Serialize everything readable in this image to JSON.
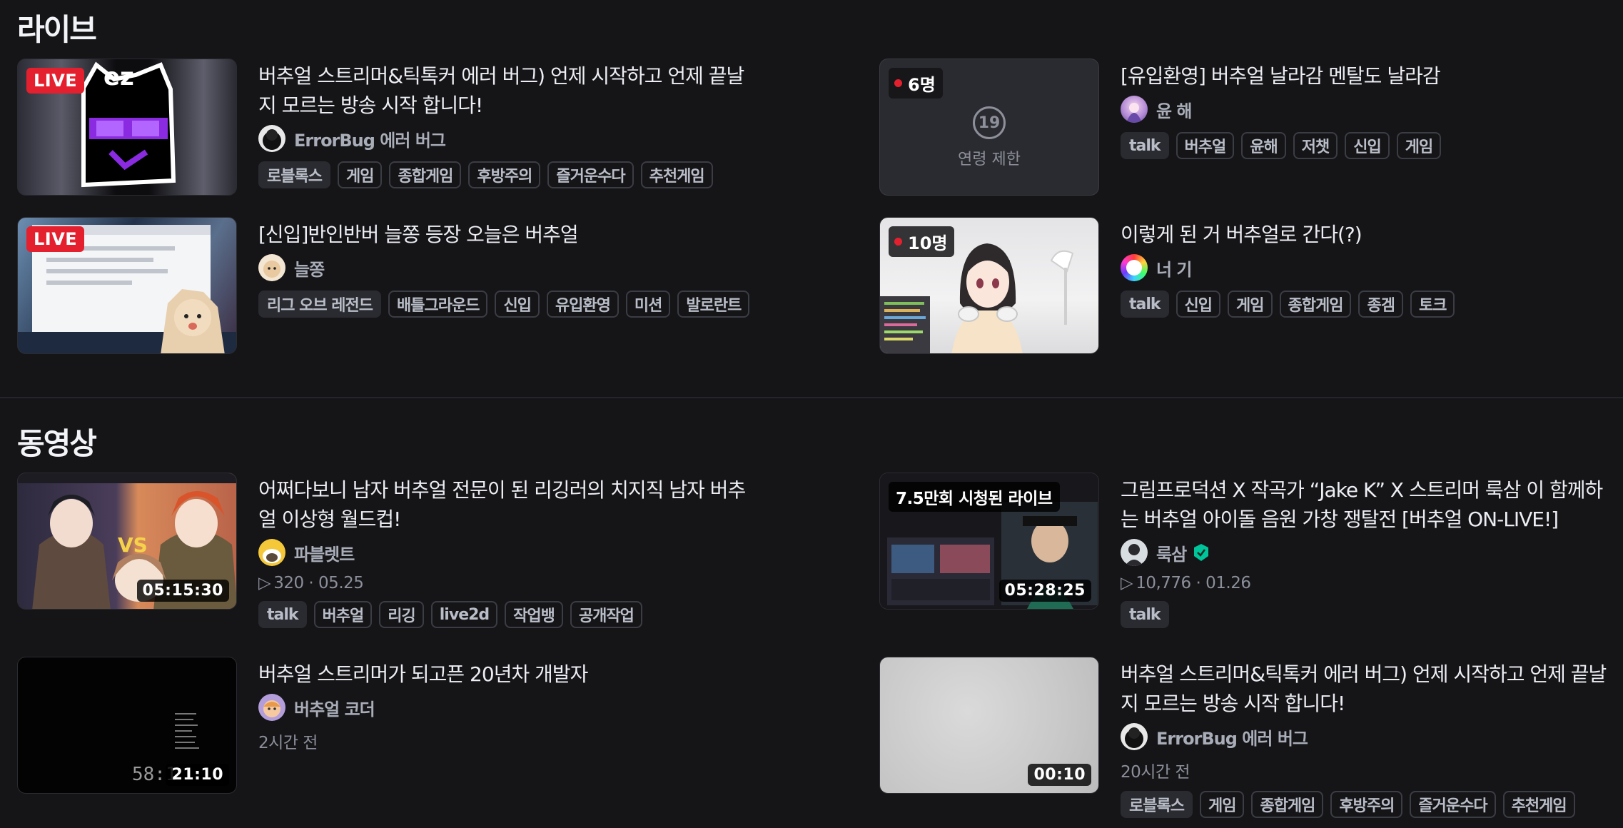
{
  "sections": {
    "live_title": "라이브",
    "video_title": "동영상"
  },
  "live": [
    {
      "badge": "LIVE",
      "title": "버추얼 스트리머&틱톡커 에러 버그) 언제 시작하고 언제 끝날지 모르는 방송 시작 합니다!",
      "channel": "ErrorBug 에러 버그",
      "tags": [
        "로블록스",
        "게임",
        "종합게임",
        "후방주의",
        "즐거운수다",
        "추천게임"
      ]
    },
    {
      "badge": "6명",
      "age_badge": "19",
      "age_text": "연령 제한",
      "title": "[유입환영] 버추얼 날라감 멘탈도 날라감",
      "channel": "윤 해",
      "tags": [
        "talk",
        "버추얼",
        "윤해",
        "저챗",
        "신입",
        "게임"
      ]
    },
    {
      "badge": "LIVE",
      "title": "[신입]반인반버 늘쫑 등장 오늘은 버추얼",
      "channel": "늘쫑",
      "tags": [
        "리그 오브 레전드",
        "배틀그라운드",
        "신입",
        "유입환영",
        "미션",
        "발로란트"
      ]
    },
    {
      "badge": "10명",
      "title": "이렇게 된 거 버추얼로 간다(?)",
      "channel": "너 기",
      "tags": [
        "talk",
        "신입",
        "게임",
        "종합게임",
        "종겜",
        "토크"
      ]
    }
  ],
  "videos": [
    {
      "duration": "05:15:30",
      "title": "어쩌다보니 남자 버추얼 전문이 된 리깅러의 치지직 남자 버추얼 이상형 월드컵!",
      "channel": "파블렛트",
      "views": "320",
      "date": "05.25",
      "tags": [
        "talk",
        "버추얼",
        "리깅",
        "live2d",
        "작업뱅",
        "공개작업"
      ]
    },
    {
      "views_badge": "7.5만회 시청된 라이브",
      "duration": "05:28:25",
      "title": "그림프로덕션 X 작곡가 “Jake K” X 스트리머 룩삼 이 함께하는 버추얼 아이돌 음원 가창 쟁탈전 [버추얼 ON-LIVE!]",
      "channel": "룩삼",
      "views": "10,776",
      "date": "01.26",
      "tags": [
        "talk"
      ]
    },
    {
      "duration": "21:10",
      "title": "버추얼 스트리머가 되고픈 20년차 개발자",
      "channel": "버추얼 코더",
      "time_ago": "2시간 전",
      "tags": []
    },
    {
      "duration": "00:10",
      "title": "버추얼 스트리머&틱톡커 에러 버그) 언제 시작하고 언제 끝날지 모르는 방송 시작 합니다!",
      "channel": "ErrorBug 에러 버그",
      "time_ago": "20시간 전",
      "tags": [
        "로블록스",
        "게임",
        "종합게임",
        "후방주의",
        "즐거운수다",
        "추천게임"
      ]
    }
  ],
  "colors": {
    "background": "#151518",
    "live_red": "#e5202e",
    "verified_green": "#00c49a"
  }
}
